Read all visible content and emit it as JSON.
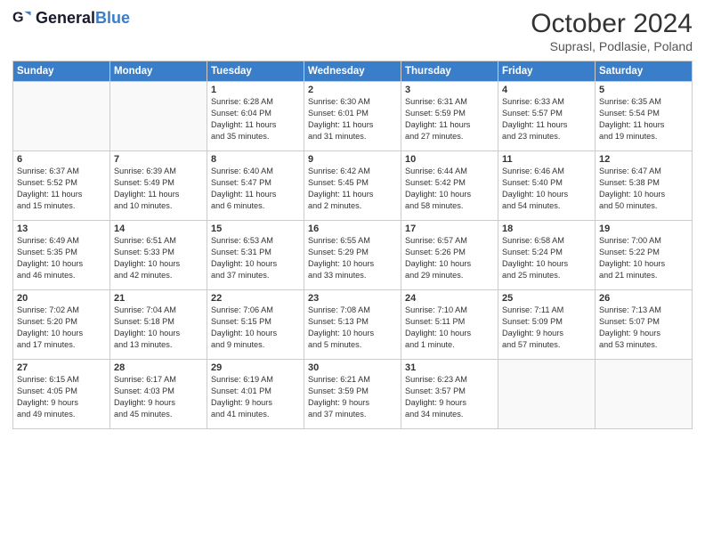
{
  "header": {
    "logo_general": "General",
    "logo_blue": "Blue",
    "month_title": "October 2024",
    "location": "Suprasl, Podlasie, Poland"
  },
  "weekdays": [
    "Sunday",
    "Monday",
    "Tuesday",
    "Wednesday",
    "Thursday",
    "Friday",
    "Saturday"
  ],
  "weeks": [
    [
      {
        "day": "",
        "empty": true
      },
      {
        "day": "",
        "empty": true
      },
      {
        "day": "1",
        "line1": "Sunrise: 6:28 AM",
        "line2": "Sunset: 6:04 PM",
        "line3": "Daylight: 11 hours",
        "line4": "and 35 minutes."
      },
      {
        "day": "2",
        "line1": "Sunrise: 6:30 AM",
        "line2": "Sunset: 6:01 PM",
        "line3": "Daylight: 11 hours",
        "line4": "and 31 minutes."
      },
      {
        "day": "3",
        "line1": "Sunrise: 6:31 AM",
        "line2": "Sunset: 5:59 PM",
        "line3": "Daylight: 11 hours",
        "line4": "and 27 minutes."
      },
      {
        "day": "4",
        "line1": "Sunrise: 6:33 AM",
        "line2": "Sunset: 5:57 PM",
        "line3": "Daylight: 11 hours",
        "line4": "and 23 minutes."
      },
      {
        "day": "5",
        "line1": "Sunrise: 6:35 AM",
        "line2": "Sunset: 5:54 PM",
        "line3": "Daylight: 11 hours",
        "line4": "and 19 minutes."
      }
    ],
    [
      {
        "day": "6",
        "line1": "Sunrise: 6:37 AM",
        "line2": "Sunset: 5:52 PM",
        "line3": "Daylight: 11 hours",
        "line4": "and 15 minutes."
      },
      {
        "day": "7",
        "line1": "Sunrise: 6:39 AM",
        "line2": "Sunset: 5:49 PM",
        "line3": "Daylight: 11 hours",
        "line4": "and 10 minutes."
      },
      {
        "day": "8",
        "line1": "Sunrise: 6:40 AM",
        "line2": "Sunset: 5:47 PM",
        "line3": "Daylight: 11 hours",
        "line4": "and 6 minutes."
      },
      {
        "day": "9",
        "line1": "Sunrise: 6:42 AM",
        "line2": "Sunset: 5:45 PM",
        "line3": "Daylight: 11 hours",
        "line4": "and 2 minutes."
      },
      {
        "day": "10",
        "line1": "Sunrise: 6:44 AM",
        "line2": "Sunset: 5:42 PM",
        "line3": "Daylight: 10 hours",
        "line4": "and 58 minutes."
      },
      {
        "day": "11",
        "line1": "Sunrise: 6:46 AM",
        "line2": "Sunset: 5:40 PM",
        "line3": "Daylight: 10 hours",
        "line4": "and 54 minutes."
      },
      {
        "day": "12",
        "line1": "Sunrise: 6:47 AM",
        "line2": "Sunset: 5:38 PM",
        "line3": "Daylight: 10 hours",
        "line4": "and 50 minutes."
      }
    ],
    [
      {
        "day": "13",
        "line1": "Sunrise: 6:49 AM",
        "line2": "Sunset: 5:35 PM",
        "line3": "Daylight: 10 hours",
        "line4": "and 46 minutes."
      },
      {
        "day": "14",
        "line1": "Sunrise: 6:51 AM",
        "line2": "Sunset: 5:33 PM",
        "line3": "Daylight: 10 hours",
        "line4": "and 42 minutes."
      },
      {
        "day": "15",
        "line1": "Sunrise: 6:53 AM",
        "line2": "Sunset: 5:31 PM",
        "line3": "Daylight: 10 hours",
        "line4": "and 37 minutes."
      },
      {
        "day": "16",
        "line1": "Sunrise: 6:55 AM",
        "line2": "Sunset: 5:29 PM",
        "line3": "Daylight: 10 hours",
        "line4": "and 33 minutes."
      },
      {
        "day": "17",
        "line1": "Sunrise: 6:57 AM",
        "line2": "Sunset: 5:26 PM",
        "line3": "Daylight: 10 hours",
        "line4": "and 29 minutes."
      },
      {
        "day": "18",
        "line1": "Sunrise: 6:58 AM",
        "line2": "Sunset: 5:24 PM",
        "line3": "Daylight: 10 hours",
        "line4": "and 25 minutes."
      },
      {
        "day": "19",
        "line1": "Sunrise: 7:00 AM",
        "line2": "Sunset: 5:22 PM",
        "line3": "Daylight: 10 hours",
        "line4": "and 21 minutes."
      }
    ],
    [
      {
        "day": "20",
        "line1": "Sunrise: 7:02 AM",
        "line2": "Sunset: 5:20 PM",
        "line3": "Daylight: 10 hours",
        "line4": "and 17 minutes."
      },
      {
        "day": "21",
        "line1": "Sunrise: 7:04 AM",
        "line2": "Sunset: 5:18 PM",
        "line3": "Daylight: 10 hours",
        "line4": "and 13 minutes."
      },
      {
        "day": "22",
        "line1": "Sunrise: 7:06 AM",
        "line2": "Sunset: 5:15 PM",
        "line3": "Daylight: 10 hours",
        "line4": "and 9 minutes."
      },
      {
        "day": "23",
        "line1": "Sunrise: 7:08 AM",
        "line2": "Sunset: 5:13 PM",
        "line3": "Daylight: 10 hours",
        "line4": "and 5 minutes."
      },
      {
        "day": "24",
        "line1": "Sunrise: 7:10 AM",
        "line2": "Sunset: 5:11 PM",
        "line3": "Daylight: 10 hours",
        "line4": "and 1 minute."
      },
      {
        "day": "25",
        "line1": "Sunrise: 7:11 AM",
        "line2": "Sunset: 5:09 PM",
        "line3": "Daylight: 9 hours",
        "line4": "and 57 minutes."
      },
      {
        "day": "26",
        "line1": "Sunrise: 7:13 AM",
        "line2": "Sunset: 5:07 PM",
        "line3": "Daylight: 9 hours",
        "line4": "and 53 minutes."
      }
    ],
    [
      {
        "day": "27",
        "line1": "Sunrise: 6:15 AM",
        "line2": "Sunset: 4:05 PM",
        "line3": "Daylight: 9 hours",
        "line4": "and 49 minutes."
      },
      {
        "day": "28",
        "line1": "Sunrise: 6:17 AM",
        "line2": "Sunset: 4:03 PM",
        "line3": "Daylight: 9 hours",
        "line4": "and 45 minutes."
      },
      {
        "day": "29",
        "line1": "Sunrise: 6:19 AM",
        "line2": "Sunset: 4:01 PM",
        "line3": "Daylight: 9 hours",
        "line4": "and 41 minutes."
      },
      {
        "day": "30",
        "line1": "Sunrise: 6:21 AM",
        "line2": "Sunset: 3:59 PM",
        "line3": "Daylight: 9 hours",
        "line4": "and 37 minutes."
      },
      {
        "day": "31",
        "line1": "Sunrise: 6:23 AM",
        "line2": "Sunset: 3:57 PM",
        "line3": "Daylight: 9 hours",
        "line4": "and 34 minutes."
      },
      {
        "day": "",
        "empty": true
      },
      {
        "day": "",
        "empty": true
      }
    ]
  ]
}
